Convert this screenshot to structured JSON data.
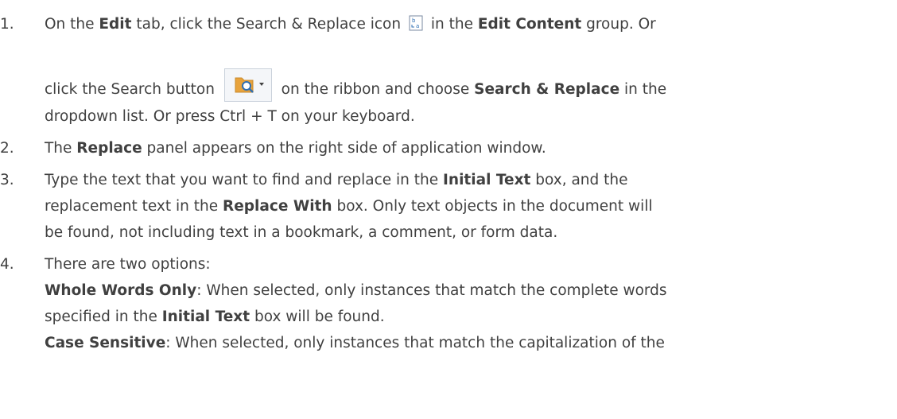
{
  "steps": [
    {
      "number": "1.",
      "line1": {
        "t1": "On the ",
        "b1": "Edit",
        "t2": " tab, click the Search & Replace icon ",
        "t3": " in the ",
        "b2": "Edit Content",
        "t4": " group. Or"
      },
      "line2": {
        "t1": "click the Search button ",
        "t2": " on the ribbon and choose ",
        "b1": "Search & Replace",
        "t3": " in the"
      },
      "line3": "dropdown list. Or press Ctrl + T on your keyboard."
    },
    {
      "number": "2.",
      "line1": {
        "t1": "The ",
        "b1": "Replace",
        "t2": " panel appears on the right side of application window."
      }
    },
    {
      "number": "3.",
      "line1": {
        "t1": "Type the text that you want to find and replace in the ",
        "b1": "Initial Text",
        "t2": " box, and the"
      },
      "line2": {
        "t1": "replacement text in the ",
        "b1": "Replace With",
        "t2": " box. Only text objects in the document will"
      },
      "line3": "be found, not including text in a bookmark, a comment, or form data."
    },
    {
      "number": "4.",
      "line1": "There are two options:",
      "line2": {
        "b1": "Whole Words Only",
        "t1": ": When selected, only instances that match the complete words"
      },
      "line3": {
        "t1": "specified in the ",
        "b1": "Initial Text",
        "t2": " box will be found."
      },
      "line4": {
        "b1": "Case Sensitive",
        "t1": ": When selected, only instances that match the capitalization of the"
      }
    }
  ],
  "icons": {
    "search_replace_icon": "search-replace-icon",
    "search_button_icon": "folder-magnifier-icon"
  },
  "colors": {
    "text": "#404040",
    "icon_orange": "#e8a33c",
    "icon_blue": "#2f6fb3"
  }
}
